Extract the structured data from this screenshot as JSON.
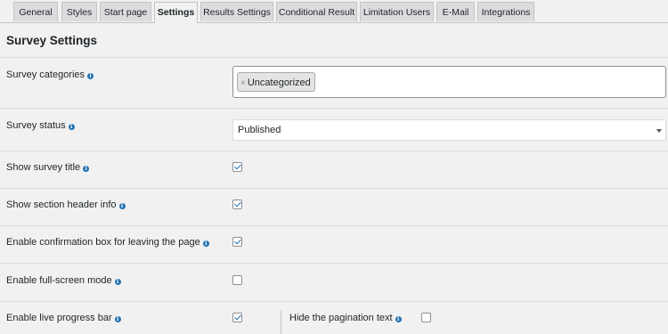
{
  "tabs": [
    {
      "label": "General",
      "active": false
    },
    {
      "label": "Styles",
      "active": false
    },
    {
      "label": "Start page",
      "active": false
    },
    {
      "label": "Settings",
      "active": true
    },
    {
      "label": "Results Settings",
      "active": false
    },
    {
      "label": "Conditional Result",
      "active": false
    },
    {
      "label": "Limitation Users",
      "active": false
    },
    {
      "label": "E-Mail",
      "active": false
    },
    {
      "label": "Integrations",
      "active": false
    }
  ],
  "section_title": "Survey Settings",
  "settings": {
    "categories": {
      "label": "Survey categories",
      "tags": [
        "Uncategorized"
      ],
      "remove_glyph": "×"
    },
    "status": {
      "label": "Survey status",
      "value": "Published"
    },
    "show_title": {
      "label": "Show survey title",
      "checked": true
    },
    "show_section_header": {
      "label": "Show section header info",
      "checked": true
    },
    "confirmation_box": {
      "label": "Enable confirmation box for leaving the page",
      "checked": true
    },
    "full_screen": {
      "label": "Enable full-screen mode",
      "checked": false
    },
    "live_progress": {
      "label": "Enable live progress bar",
      "checked": true
    },
    "hide_pagination": {
      "label": "Hide the pagination text",
      "checked": false
    }
  },
  "icons": {
    "info": "info-icon",
    "dropdown": "chevron-down-icon"
  },
  "colors": {
    "accent": "#2271b1",
    "background": "#f1f1f1",
    "tab_inactive": "#dcdcde"
  }
}
